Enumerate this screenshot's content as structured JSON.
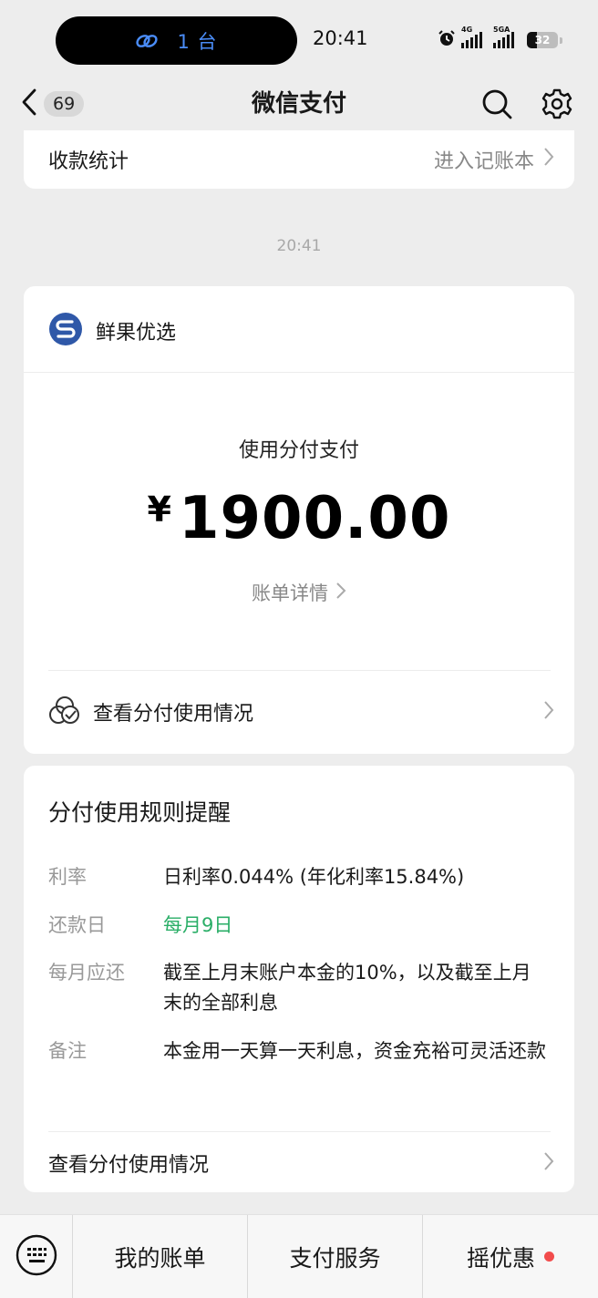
{
  "status_bar": {
    "island_count": "1 台",
    "time": "20:41",
    "signal_1": "4G",
    "signal_2": "5GA",
    "battery": "32"
  },
  "nav": {
    "unread_count": "69",
    "title": "微信支付"
  },
  "stats_card": {
    "label": "收款统计",
    "link": "进入记账本"
  },
  "timestamp": "20:41",
  "payment_card": {
    "merchant": "鲜果优选",
    "pay_method": "使用分付支付",
    "currency": "¥",
    "amount": "1900.00",
    "detail_link": "账单详情",
    "usage_link": "查看分付使用情况"
  },
  "rules_card": {
    "title": "分付使用规则提醒",
    "rows": [
      {
        "key": "利率",
        "value": "日利率0.044% (年化利率15.84%)"
      },
      {
        "key": "还款日",
        "value": "每月9日"
      },
      {
        "key": "每月应还",
        "value": "截至上月末账户本金的10%，以及截至上月末的全部利息"
      },
      {
        "key": "备注",
        "value": "本金用一天算一天利息，资金充裕可灵活还款"
      }
    ],
    "footer_link": "查看分付使用情况"
  },
  "bottom_bar": {
    "items": [
      "我的账单",
      "支付服务",
      "摇优惠"
    ]
  },
  "colors": {
    "accent_green": "#2aae67",
    "merchant_blue": "#2f58a8",
    "notify_red": "#f24c4c",
    "island_blue": "#4a8cf7"
  }
}
